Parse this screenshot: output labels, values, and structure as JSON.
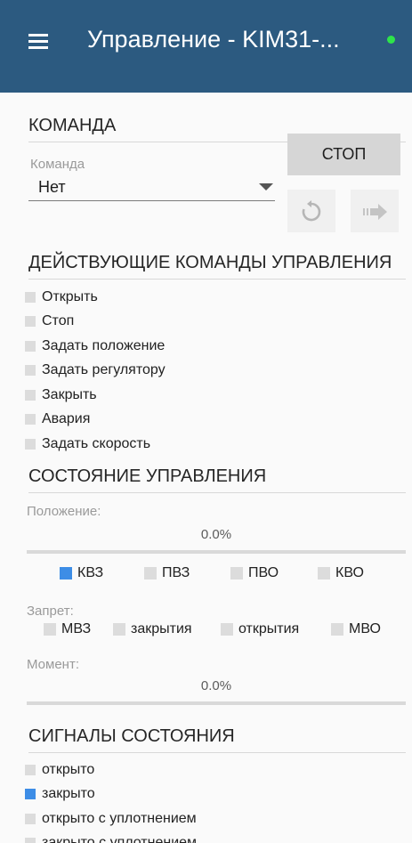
{
  "header": {
    "title": "Управление - KIM31-...",
    "menu_icon": "menu-icon",
    "status_color": "#2ee44a"
  },
  "command": {
    "section_title": "КОМАНДА",
    "select_label": "Команда",
    "select_value": "Нет",
    "stop_label": "СТОП",
    "undo_icon": "undo-icon",
    "send_icon": "arrow-right-icon"
  },
  "active_commands": {
    "section_title": "ДЕЙСТВУЮЩИЕ КОМАНДЫ УПРАВЛЕНИЯ",
    "items": [
      {
        "label": "Открыть",
        "checked": false
      },
      {
        "label": "Стоп",
        "checked": false
      },
      {
        "label": "Задать положение",
        "checked": false
      },
      {
        "label": "Задать регулятору",
        "checked": false
      },
      {
        "label": "Закрыть",
        "checked": false
      },
      {
        "label": "Авария",
        "checked": false
      },
      {
        "label": "Задать скорость",
        "checked": false
      }
    ]
  },
  "control_state": {
    "section_title": "СОСТОЯНИЕ УПРАВЛЕНИЯ",
    "position_label": "Положение:",
    "position_value": "0.0%",
    "position_fraction": 0.0,
    "limits": [
      {
        "label": "КВЗ",
        "checked": true
      },
      {
        "label": "ПВЗ",
        "checked": true
      },
      {
        "label": "ПВО",
        "checked": false
      },
      {
        "label": "КВО",
        "checked": false
      }
    ],
    "ban_label": "Запрет:",
    "bans": [
      {
        "label": "МВЗ",
        "checked": false
      },
      {
        "label": "закрытия",
        "checked": false
      },
      {
        "label": "открытия",
        "checked": false
      },
      {
        "label": "МВО",
        "checked": false
      }
    ],
    "moment_label": "Момент:",
    "moment_value": "0.0%",
    "moment_fraction": 0.0
  },
  "signals": {
    "section_title": "СИГНАЛЫ СОСТОЯНИЯ",
    "items": [
      {
        "label": "открыто",
        "checked": false
      },
      {
        "label": "закрыто",
        "checked": true
      },
      {
        "label": "открыто с уплотнением",
        "checked": false
      },
      {
        "label": "закрыто с уплотнением",
        "checked": false
      }
    ]
  },
  "colors": {
    "accent": "#2c5a80",
    "checked": "#3d8de6",
    "unchecked": "#dcdcdc"
  }
}
